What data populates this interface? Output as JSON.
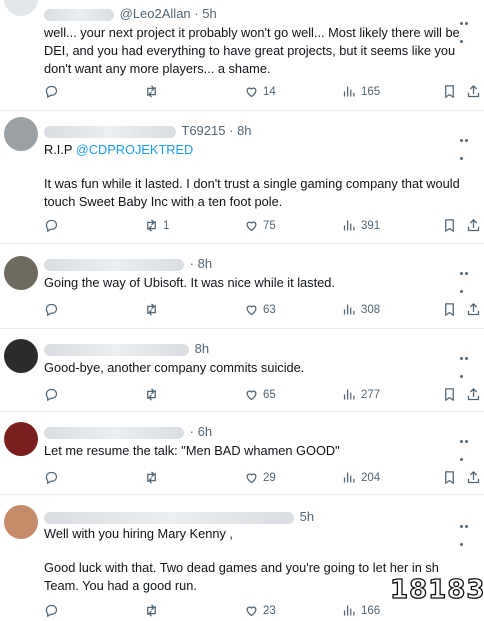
{
  "tweets": [
    {
      "handle": "@Leo2Allan",
      "sep": "·",
      "time": "5h",
      "text_lines": [
        "well... your next project it probably won't go well... Most likely there will be DEI, and you had everything to have great projects, but it seems like you don't want any more players... a shame."
      ],
      "retweets": "",
      "likes": "14",
      "views": "165",
      "avatar_color": "#e4e7ea"
    },
    {
      "handle": "T69215",
      "sep": "·",
      "time": "8h",
      "text_prefix": "R.I.P ",
      "mention": "@CDPROJEKTRED",
      "text_lines": [
        "It was fun while it lasted. I don't trust a single gaming company that would touch Sweet Baby Inc with a ten foot pole."
      ],
      "retweets": "1",
      "likes": "75",
      "views": "391",
      "avatar_color": "#9aa0a4"
    },
    {
      "handle": "",
      "sep": "·",
      "time": "8h",
      "text_lines": [
        "Going the way of Ubisoft. It was nice while it lasted."
      ],
      "retweets": "",
      "likes": "63",
      "views": "308",
      "avatar_color": "#6e6a60"
    },
    {
      "handle": "",
      "sep": "",
      "time": "8h",
      "text_lines": [
        "Good-bye, another company commits suicide."
      ],
      "retweets": "",
      "likes": "65",
      "views": "277",
      "avatar_color": "#2b2b2e"
    },
    {
      "handle": "",
      "sep": "·",
      "time": "6h",
      "text_lines": [
        "Let me resume the talk: \"Men BAD whamen GOOD\""
      ],
      "retweets": "",
      "likes": "29",
      "views": "204",
      "avatar_color": "#7a1f1f"
    },
    {
      "handle": "",
      "sep": "",
      "time": "5h",
      "text_lines": [
        "Well with you hiring Mary Kenny ,",
        "Good luck with that. Two dead games and you're going to let her in sh",
        "Team. You had a good run."
      ],
      "retweets": "",
      "likes": "23",
      "views": "166",
      "avatar_color": "#c58b6a"
    }
  ],
  "icons": {
    "reply": "reply-icon",
    "retweet": "retweet-icon",
    "like": "heart-icon",
    "views": "views-icon",
    "bookmark": "bookmark-icon",
    "share": "share-icon",
    "more": "more-icon"
  },
  "watermark": {
    "text": "18183"
  },
  "colors": {
    "text": "#0f1419",
    "muted": "#536471",
    "link": "#1d9bf0",
    "divider": "#e6ecf0"
  }
}
